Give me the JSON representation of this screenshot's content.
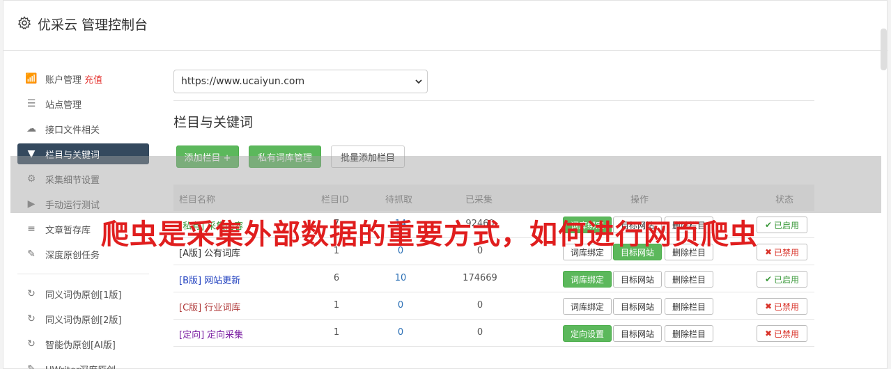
{
  "header": {
    "title": "优采云 管理控制台"
  },
  "sidebar": {
    "items": [
      {
        "label": "账户管理",
        "badge": "充值",
        "icon": "bar-chart-icon",
        "glyph": "📶"
      },
      {
        "label": "站点管理",
        "icon": "server-icon",
        "glyph": "☰"
      },
      {
        "label": "接口文件相关",
        "icon": "cloud-upload-icon",
        "glyph": "☁"
      },
      {
        "label": "栏目与关键词",
        "icon": "filter-icon",
        "glyph": "▼",
        "active": true
      },
      {
        "label": "采集细节设置",
        "icon": "cogs-icon",
        "glyph": "⚙"
      },
      {
        "label": "手动运行测试",
        "icon": "play-circle-icon",
        "glyph": "▶"
      },
      {
        "label": "文章暂存库",
        "icon": "database-icon",
        "glyph": "≡"
      },
      {
        "label": "深度原创任务",
        "icon": "edit-icon",
        "glyph": "✎"
      },
      {
        "label": "同义词伪原创[1版]",
        "icon": "refresh-icon",
        "glyph": "↻"
      },
      {
        "label": "同义词伪原创[2版]",
        "icon": "refresh-icon",
        "glyph": "↻"
      },
      {
        "label": "智能伪原创[AI版]",
        "icon": "refresh-icon",
        "glyph": "↻"
      },
      {
        "label": "UWriter深度原创",
        "icon": "edit-icon",
        "glyph": "✎"
      }
    ]
  },
  "main": {
    "site_select": {
      "value": "https://www.ucaiyun.com"
    },
    "section_title": "栏目与关键词",
    "buttons": {
      "add_column": "添加栏目 +",
      "private_lib": "私有词库管理",
      "batch_add": "批量添加栏目"
    },
    "table": {
      "headers": [
        "栏目名称",
        "栏目ID",
        "待抓取",
        "已采集",
        "操作",
        "状态"
      ],
      "rows": [
        {
          "tag": "[私有]",
          "name": "采集内容",
          "id": "7",
          "pending": "14",
          "collected": "92460",
          "op1": "词库绑定",
          "op1_green": true,
          "op2": "目标网站",
          "op2_green": false,
          "op3": "删除栏目",
          "status": "已启用",
          "enabled": true,
          "color": "#3c9a3c"
        },
        {
          "tag": "[A版]",
          "name": "公有词库",
          "id": "1",
          "pending": "0",
          "collected": "0",
          "op1": "词库绑定",
          "op1_green": false,
          "op2": "目标网站",
          "op2_green": true,
          "op3": "删除栏目",
          "status": "已禁用",
          "enabled": false,
          "color": "#333333"
        },
        {
          "tag": "[B版]",
          "name": "网站更新",
          "id": "6",
          "pending": "10",
          "collected": "174669",
          "op1": "词库绑定",
          "op1_green": true,
          "op2": "目标网站",
          "op2_green": false,
          "op3": "删除栏目",
          "status": "已启用",
          "enabled": true,
          "color": "#1f3fbf"
        },
        {
          "tag": "[C版]",
          "name": "行业词库",
          "id": "1",
          "pending": "0",
          "collected": "0",
          "op1": "词库绑定",
          "op1_green": false,
          "op2": "目标网站",
          "op2_green": false,
          "op3": "删除栏目",
          "status": "已禁用",
          "enabled": false,
          "color": "#b03a3a"
        },
        {
          "tag": "[定向]",
          "name": "定向采集",
          "id": "1",
          "pending": "0",
          "collected": "0",
          "op1": "定向设置",
          "op1_green": true,
          "op2": "目标网站",
          "op2_green": false,
          "op3": "删除栏目",
          "status": "已禁用",
          "enabled": false,
          "color": "#7b1fa2"
        }
      ]
    }
  },
  "overlay": {
    "text": "爬虫是采集外部数据的重要方式，如何进行网页爬虫"
  },
  "colors": {
    "accent_green": "#5cb85c",
    "nav_active": "#34495e",
    "danger": "#d9342b"
  }
}
